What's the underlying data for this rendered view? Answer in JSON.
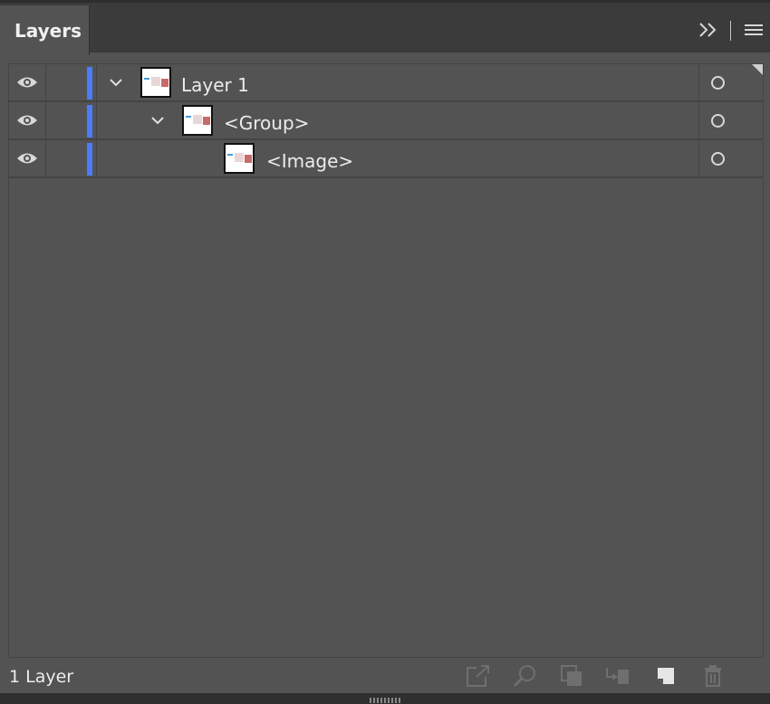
{
  "panel": {
    "tab_label": "Layers",
    "status_text": "1 Layer"
  },
  "icons": {
    "expand": "double-chevron-right-icon",
    "menu": "hamburger-menu-icon",
    "visibility": "eye-icon",
    "disclosure": "chevron-down-icon",
    "target": "target-circle-icon",
    "bottom_buttons": [
      "collect-for-export-icon",
      "locate-object-icon",
      "make-clipping-mask-icon",
      "create-sublayer-icon",
      "create-new-layer-icon",
      "delete-icon"
    ]
  },
  "colors": {
    "layer_color": "#4a7dfd",
    "panel_bg": "#535353"
  },
  "layers": [
    {
      "name": "Layer 1",
      "expanded": true,
      "visible": true
    },
    {
      "name": "<Group>",
      "expanded": true,
      "visible": true
    },
    {
      "name": "<Image>",
      "visible": true
    }
  ]
}
